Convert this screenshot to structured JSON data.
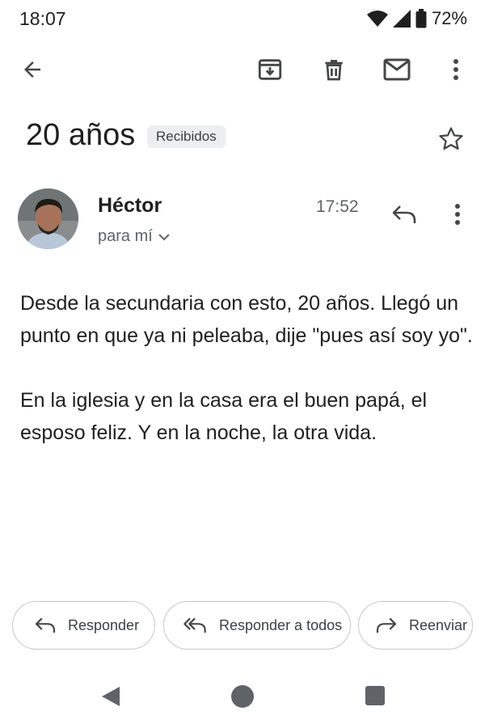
{
  "status_bar": {
    "time": "18:07",
    "battery": "72%"
  },
  "toolbar": {
    "back_icon": "arrow-back-icon",
    "archive_icon": "archive-icon",
    "delete_icon": "trash-icon",
    "mark_unread_icon": "mail-icon",
    "more_icon": "more-vert-icon"
  },
  "email": {
    "subject": "20 años",
    "label": "Recibidos",
    "sender": "Héctor",
    "recipient": "para mí",
    "time": "17:52",
    "body": [
      "Desde la secundaria con esto, 20 años. Llegó un punto en que ya ni peleaba, dije \"pues así soy yo\".",
      "En la iglesia y en la casa era el buen papá, el esposo feliz. Y en la noche, la otra vida."
    ]
  },
  "actions": {
    "reply": "Responder",
    "reply_all": "Responder a todos",
    "forward": "Reenviar"
  },
  "colors": {
    "icon": "#444746",
    "text": "#1f1f1f",
    "muted": "#5f6368",
    "chip_bg": "#eceeef"
  }
}
